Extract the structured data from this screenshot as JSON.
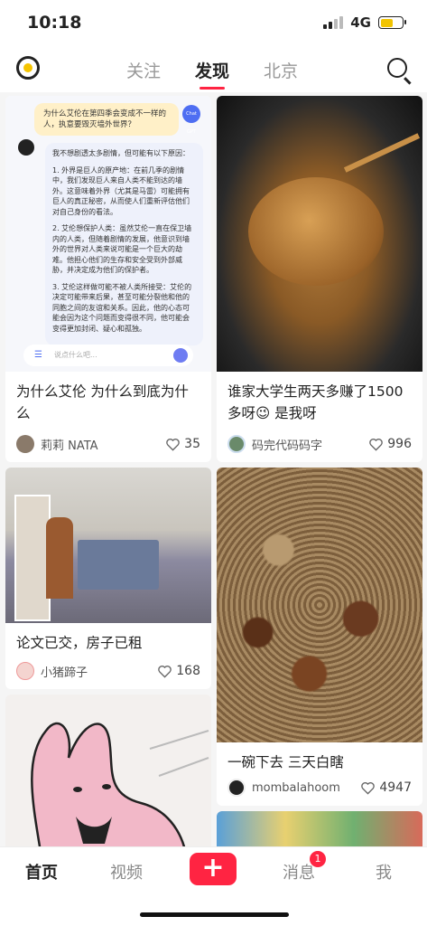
{
  "status": {
    "time": "10:18",
    "network": "4G"
  },
  "nav": {
    "tabs": [
      "关注",
      "发现",
      "北京"
    ],
    "active_tab": "发现"
  },
  "cards": [
    {
      "title": "为什么艾伦 为什么到底为什么",
      "author": "莉莉 NATA",
      "likes": "35",
      "chat": {
        "question": "为什么艾伦在第四季会变成不一样的人，执意要毁灭墙外世界？",
        "q_avatar": "Chat GPT",
        "answer_intro": "我不想剧透太多剧情，但可能有以下原因：",
        "answer_1": "1. 外界是巨人的原产地：在前几季的剧情中，我们发现巨人来自人类不能到达的墙外。这意味着外界（尤其是马雷）可能拥有巨人的真正秘密，从而使人们重新评估他们对自己身份的看法。",
        "answer_2": "2. 艾伦想保护人类：虽然艾伦一直在保卫墙内的人类，但随着剧情的发展，他意识到墙外的世界对人类来说可能是一个巨大的劫难。他担心他们的生存和安全受到外部威胁，并决定成为他们的保护者。",
        "answer_3": "3. 艾伦这样做可能不被人类所接受：艾伦的决定可能带来后果，甚至可能分裂他和他的同胞之间的友谊和关系。因此，他的心态可能会因为这个问题而变得很不同，他可能会变得更加封闭、疑心和孤独。",
        "input_placeholder": "说点什么吧..."
      }
    },
    {
      "title": "谁家大学生两天多赚了1500多呀😉 是我呀",
      "author": "码完代码码字",
      "likes": "996"
    },
    {
      "title": "论文已交，房子已租",
      "author": "小猪蹄子",
      "likes": "168"
    },
    {
      "title": "一碗下去 三天白瞎",
      "author": "mombalahoom",
      "likes": "4947"
    }
  ],
  "bottom_nav": {
    "home": "首页",
    "video": "视频",
    "plus": "+",
    "messages": "消息",
    "messages_badge": "1",
    "me": "我"
  },
  "colors": {
    "accent": "#ff2442"
  }
}
